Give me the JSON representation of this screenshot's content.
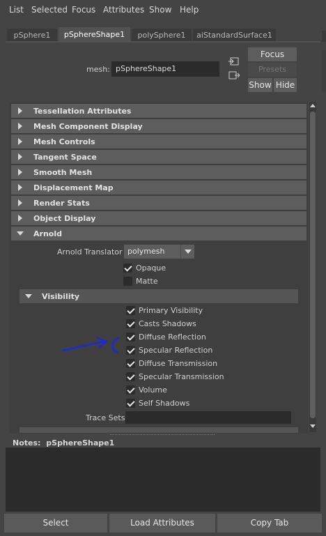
{
  "menu": [
    "List",
    "Selected",
    "Focus",
    "Attributes",
    "Show",
    "Help"
  ],
  "tabs": [
    {
      "label": "pSphere1",
      "active": false
    },
    {
      "label": "pSphereShape1",
      "active": true
    },
    {
      "label": "polySphere1",
      "active": false
    },
    {
      "label": "aiStandardSurface1",
      "active": false
    }
  ],
  "mesh": {
    "label": "mesh:",
    "value": "pSphereShape1"
  },
  "buttons": {
    "focus": "Focus",
    "presets": "Presets",
    "show": "Show",
    "hide": "Hide"
  },
  "sections": [
    "Tessellation Attributes",
    "Mesh Component Display",
    "Mesh Controls",
    "Tangent Space",
    "Smooth Mesh",
    "Displacement Map",
    "Render Stats",
    "Object Display"
  ],
  "arnold": {
    "title": "Arnold",
    "translator_label": "Arnold Translator",
    "translator_value": "polymesh",
    "opaque": "Opaque",
    "matte": "Matte",
    "visibility": {
      "title": "Visibility",
      "items": [
        "Primary Visibility",
        "Casts Shadows",
        "Diffuse Reflection",
        "Specular Reflection",
        "Diffuse Transmission",
        "Specular Transmission",
        "Volume",
        "Self Shadows"
      ]
    },
    "trace_sets_label": "Trace Sets"
  },
  "notes": {
    "label": "Notes:",
    "value": "pSphereShape1"
  },
  "bottom_buttons": [
    "Select",
    "Load Attributes",
    "Copy Tab"
  ],
  "colors": {
    "annotation": "#1a2bd6"
  }
}
